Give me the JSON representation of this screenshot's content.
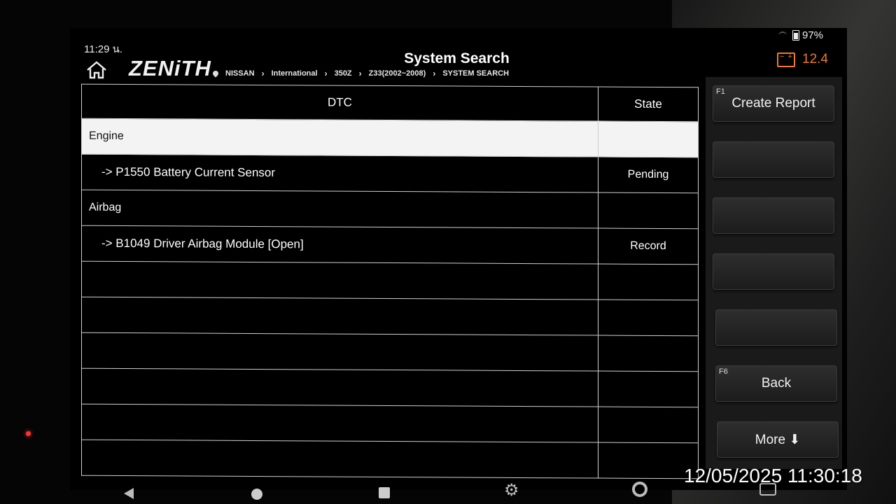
{
  "status_bar": {
    "time": "11:29 น.",
    "battery": "97%"
  },
  "header": {
    "logo": "ZENiTH",
    "title": "System Search",
    "breadcrumb": [
      "NISSAN",
      "International",
      "350Z",
      "Z33(2002~2008)",
      "SYSTEM SEARCH"
    ],
    "voltage": "12.4"
  },
  "table": {
    "columns": [
      "DTC",
      "State"
    ],
    "rows": [
      {
        "type": "category",
        "label": "Engine",
        "selected": true
      },
      {
        "type": "dtc",
        "label": "->  P1550 Battery Current Sensor",
        "state": "Pending"
      },
      {
        "type": "category",
        "label": "Airbag"
      },
      {
        "type": "dtc",
        "label": "->  B1049 Driver Airbag Module [Open]",
        "state": "Record"
      }
    ]
  },
  "function_keys": [
    {
      "key": "F1",
      "label": "Create Report"
    },
    {
      "key": "",
      "label": ""
    },
    {
      "key": "",
      "label": ""
    },
    {
      "key": "",
      "label": ""
    },
    {
      "key": "",
      "label": ""
    },
    {
      "key": "F6",
      "label": "Back"
    },
    {
      "key": "",
      "label": "More ⬇"
    }
  ],
  "photo_timestamp": "12/05/2025 11:30:18",
  "colors": {
    "accent": "#f07b22",
    "selected_row": "#f3f3f3"
  }
}
